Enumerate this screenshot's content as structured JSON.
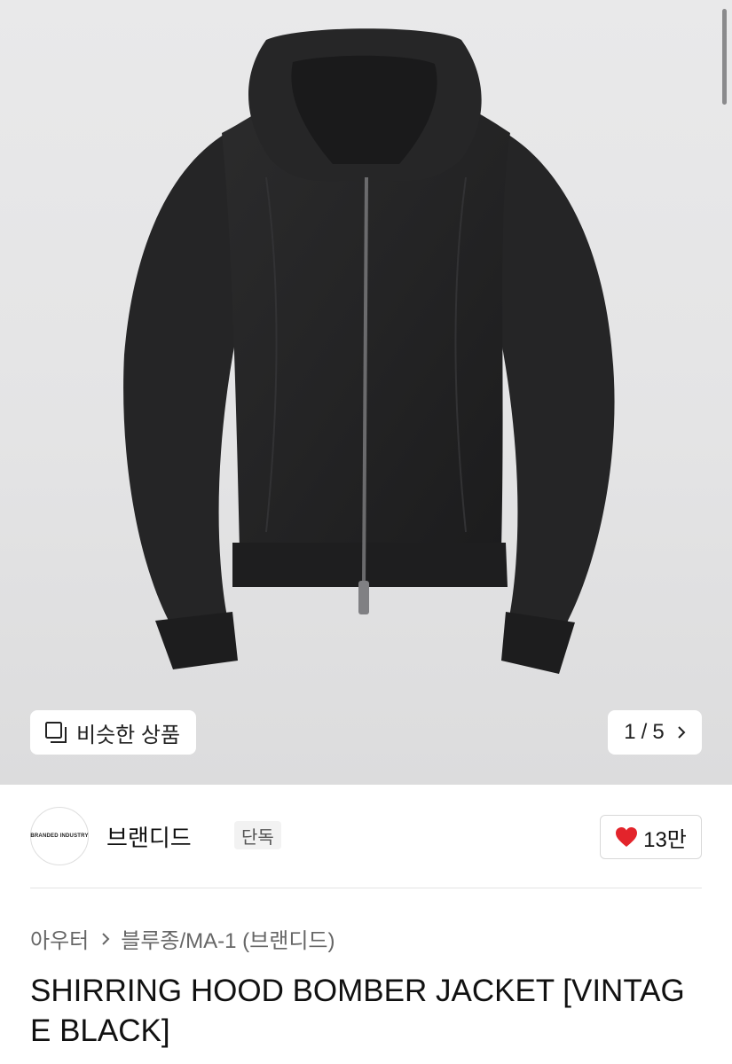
{
  "product_image": {
    "alt": "SHIRRING HOOD BOMBER JACKET [VINTAGE BLACK]",
    "similar_button_label": "비슷한 상품",
    "similar_icon": "copy-icon",
    "pagination": {
      "current": "1",
      "separator": "/",
      "total": "5",
      "next_icon": "chevron-right-icon"
    }
  },
  "seller": {
    "avatar_text": "BRANDED INDUSTRY",
    "name": "브랜디드",
    "badge": "단독",
    "likes": "13만",
    "like_icon": "heart-icon",
    "like_color": "#e3242b"
  },
  "breadcrumb": {
    "category": "아우터",
    "subcategory": "블루종/MA-1 (브랜디드)",
    "separator_icon": "chevron-right-icon"
  },
  "product": {
    "title": "SHIRRING HOOD BOMBER JACKET [VINTAGE BLACK]"
  }
}
